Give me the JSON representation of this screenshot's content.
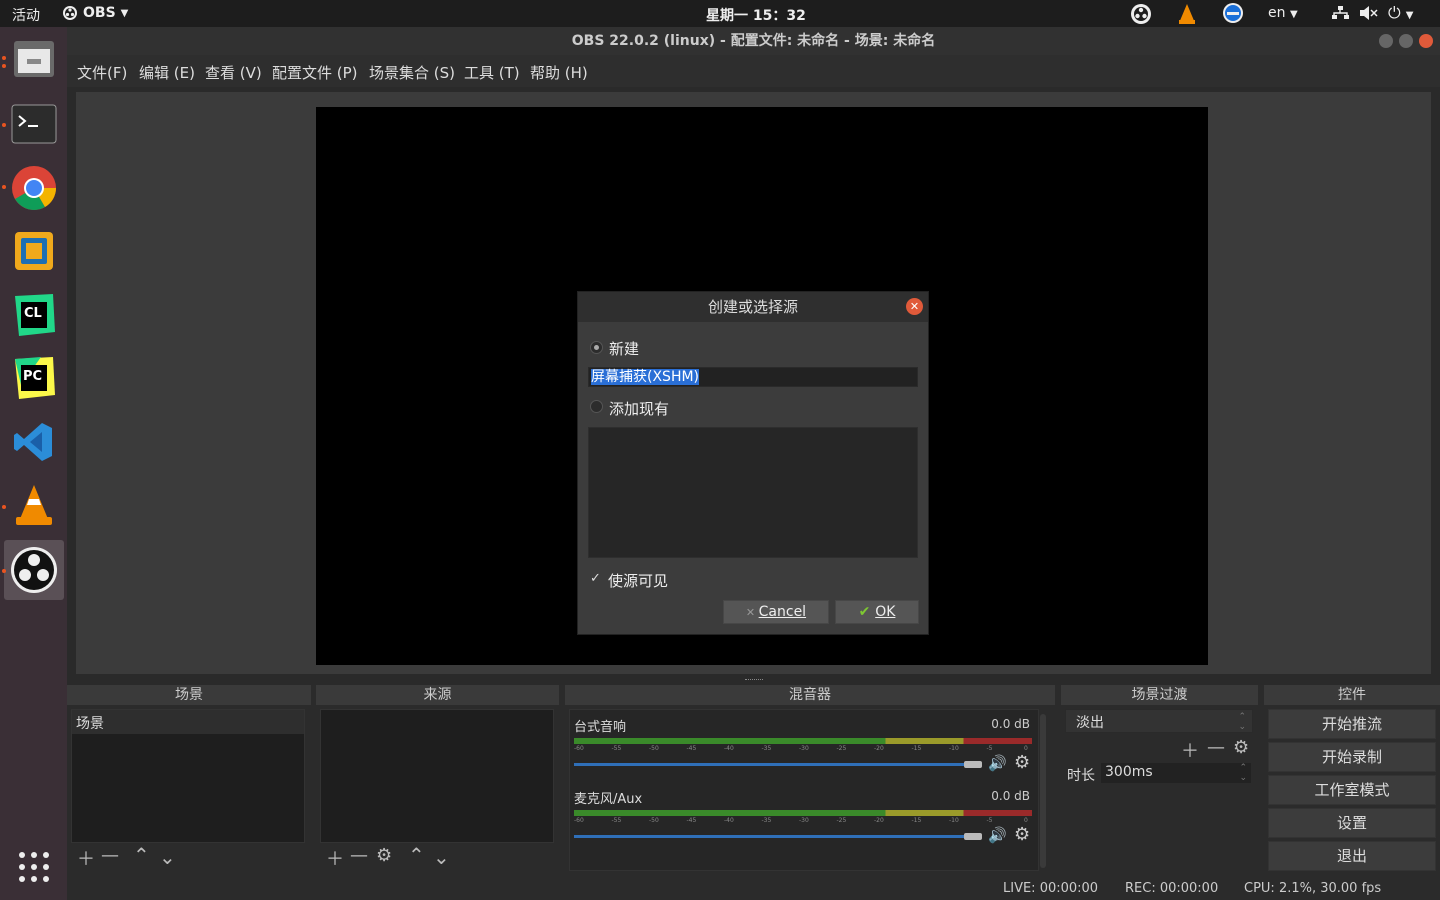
{
  "topbar": {
    "activities": "活动",
    "app_name": "OBS",
    "clock": "星期一 15：32",
    "lang": "en"
  },
  "window": {
    "title": "OBS 22.0.2 (linux) - 配置文件: 未命名 - 场景: 未命名"
  },
  "menu": [
    "文件(F)",
    "编辑 (E)",
    "查看 (V)",
    "配置文件 (P)",
    "场景集合 (S)",
    "工具 (T)",
    "帮助 (H)"
  ],
  "dialog": {
    "title": "创建或选择源",
    "new_label": "新建",
    "name_value": "屏幕捕获(XSHM)",
    "existing_label": "添加现有",
    "visible_label": "使源可见",
    "cancel_label": "Cancel",
    "ok_label": "OK"
  },
  "scenes": {
    "title": "场景",
    "items": [
      "场景"
    ]
  },
  "sources": {
    "title": "来源"
  },
  "mixer": {
    "title": "混音器",
    "tracks": [
      {
        "name": "台式音响",
        "db": "0.0 dB"
      },
      {
        "name": "麦克风/Aux",
        "db": "0.0 dB"
      }
    ],
    "scale": [
      "-60",
      "-55",
      "-50",
      "-45",
      "-40",
      "-35",
      "-30",
      "-25",
      "-20",
      "-15",
      "-10",
      "-5",
      "0"
    ]
  },
  "transitions": {
    "title": "场景过渡",
    "selected": "淡出",
    "duration_label": "时长",
    "duration_value": "300ms"
  },
  "controls": {
    "title": "控件",
    "buttons": [
      "开始推流",
      "开始录制",
      "工作室模式",
      "设置",
      "退出"
    ]
  },
  "status": {
    "live": "LIVE: 00:00:00",
    "rec": "REC: 00:00:00",
    "cpu": "CPU: 2.1%, 30.00 fps"
  },
  "colors": {
    "accent": "#e95420",
    "selection": "#2a6fd6",
    "meter_green": "#3a8a2a",
    "meter_yellow": "#9a9a2a",
    "meter_red": "#9a2a2a"
  }
}
